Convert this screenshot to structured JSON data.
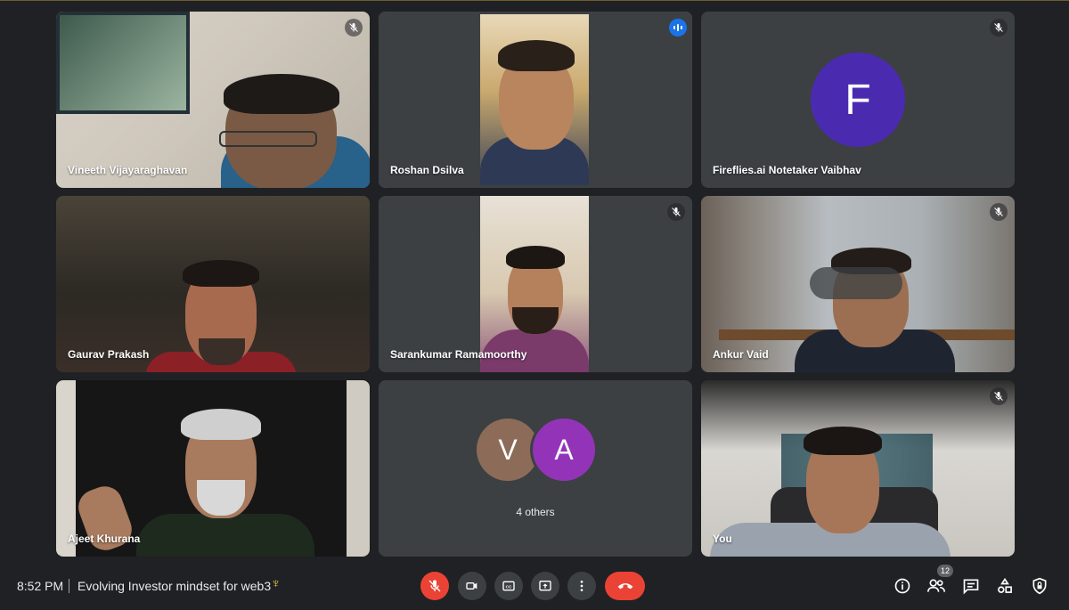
{
  "participants": [
    {
      "name": "Vineeth Vijayaraghavan",
      "muted": true
    },
    {
      "name": "Roshan Dsilva",
      "speaking": true
    },
    {
      "name": "Fireflies.ai Notetaker Vaibhav",
      "muted": true,
      "avatar_letter": "F",
      "avatar_color": "#4a2bb0"
    },
    {
      "name": "Gaurav Prakash",
      "muted": false
    },
    {
      "name": "Sarankumar Ramamoorthy",
      "muted": true
    },
    {
      "name": "Ankur Vaid",
      "muted": true
    },
    {
      "name": "Ajeet Khurana",
      "muted": false
    },
    {
      "others_label": "4 others",
      "avatars": [
        {
          "letter": "V",
          "color": "#8c6c58"
        },
        {
          "letter": "A",
          "color": "#9334b8"
        }
      ]
    },
    {
      "name": "You",
      "muted": true
    }
  ],
  "bottom_bar": {
    "time": "8:52 PM",
    "separator": "|",
    "meeting_title": "Evolving Investor mindset for web3",
    "title_emoji": "♆",
    "people_count": "12"
  },
  "colors": {
    "accent": "#8ab4f8",
    "danger": "#ea4335",
    "background": "#202124",
    "tile": "#3c4043"
  },
  "icons": [
    "mic-off-icon",
    "speaking-icon",
    "camera-icon",
    "captions-icon",
    "present-icon",
    "more-options-icon",
    "end-call-icon",
    "info-icon",
    "people-icon",
    "chat-icon",
    "activities-icon",
    "host-controls-icon"
  ]
}
